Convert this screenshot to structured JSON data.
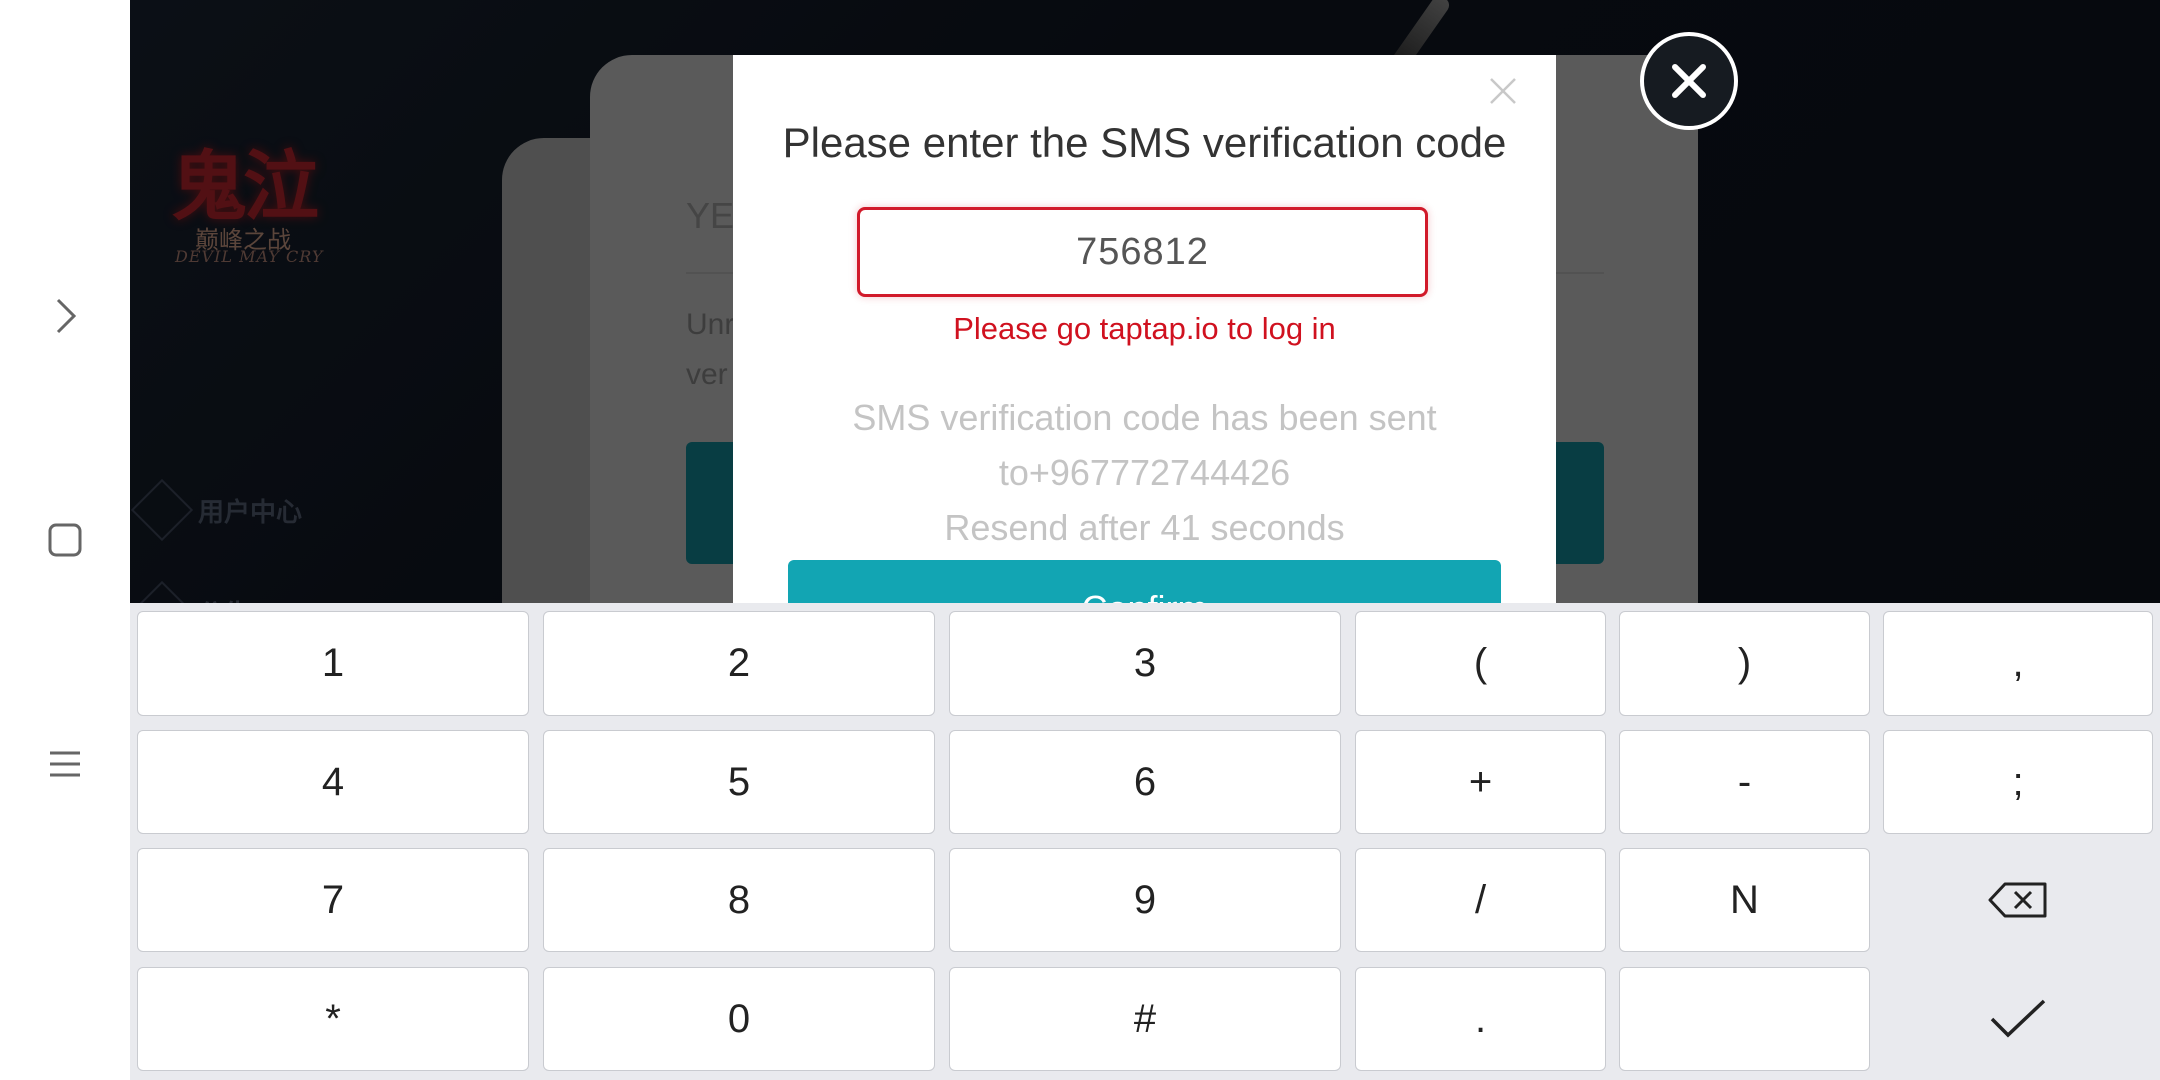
{
  "game": {
    "logo_cn": "鬼泣",
    "logo_subtitle": "巅峰之战",
    "logo_en": "DEVIL MAY CRY",
    "menu": [
      "用户中心",
      "公告"
    ]
  },
  "background_dialog": {
    "title_fragment": "YE",
    "text_line1": "Unr",
    "text_line2": "ver"
  },
  "modal": {
    "title": "Please enter the SMS verification code",
    "code_value": "756812",
    "error": "Please go taptap.io to log in",
    "sent_line1": "SMS verification code has been sent",
    "sent_line2": "to+967772744426",
    "resend": "Resend after 41 seconds",
    "confirm_label": "Confirm"
  },
  "keyboard": {
    "row1": [
      "1",
      "2",
      "3",
      "(",
      ")",
      ","
    ],
    "row2": [
      "4",
      "5",
      "6",
      "+",
      "-",
      ";"
    ],
    "row3": [
      "7",
      "8",
      "9",
      "/",
      "N"
    ],
    "row4": [
      "*",
      "0",
      "#",
      ".",
      ""
    ]
  },
  "colors": {
    "accent": "#12a5b3",
    "error": "#d0111f"
  }
}
